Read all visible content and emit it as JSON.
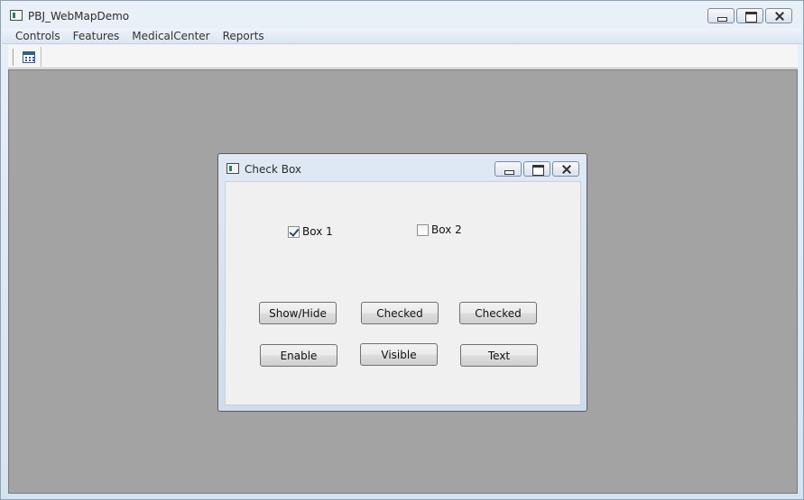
{
  "app": {
    "title": "PBJ_WebMapDemo"
  },
  "menubar": {
    "items": [
      "Controls",
      "Features",
      "MedicalCenter",
      "Reports"
    ]
  },
  "toolbar": {
    "buttons": [
      {
        "icon": "calendar-icon"
      }
    ]
  },
  "child_window": {
    "title": "Check Box",
    "checkboxes": [
      {
        "label": "Box 1",
        "checked": true
      },
      {
        "label": "Box 2",
        "checked": false
      }
    ],
    "buttons": {
      "show_hide": "Show/Hide",
      "checked_1": "Checked",
      "checked_2": "Checked",
      "enable": "Enable",
      "visible": "Visible",
      "text": "Text"
    }
  }
}
